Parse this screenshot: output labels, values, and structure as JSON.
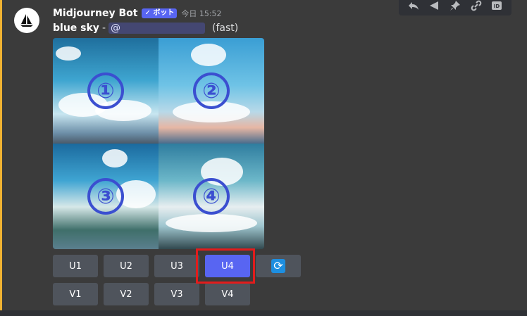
{
  "message": {
    "username": "Midjourney Bot",
    "badge": "✓ ボット",
    "timestamp": "今日 15:52",
    "prompt": "blue sky",
    "separator": "-",
    "mention": "@",
    "mode": "(fast)"
  },
  "grid": {
    "labels": [
      "①",
      "②",
      "③",
      "④"
    ]
  },
  "buttons": {
    "upscale": [
      "U1",
      "U2",
      "U3",
      "U4"
    ],
    "variation": [
      "V1",
      "V2",
      "V3",
      "V4"
    ],
    "selected": "U4",
    "reroll_icon": "refresh-icon"
  },
  "toolbar": {
    "icons": [
      "reply-icon",
      "thread-icon",
      "pin-icon",
      "link-icon",
      "id-icon"
    ]
  },
  "colors": {
    "accent_bar": "#f0b232",
    "bot_badge": "#5865f2",
    "selected_button": "#5865f2",
    "highlight": "#e21c1c"
  }
}
